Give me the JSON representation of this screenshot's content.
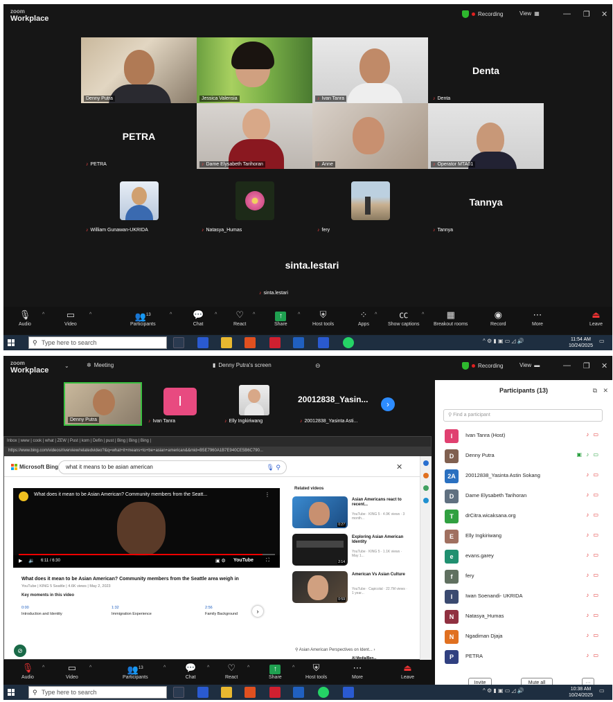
{
  "app": {
    "logo_top": "zoom",
    "logo_bottom": "Workplace"
  },
  "shot1": {
    "recording": "Recording",
    "view": "View",
    "tiles": [
      {
        "name": "Denny Putra"
      },
      {
        "name": "Jessica Valensia"
      },
      {
        "name": "Ivan Tanra"
      },
      {
        "name": "Denta",
        "big": "Denta"
      },
      {
        "name": "PETRA",
        "big": "PETRA"
      },
      {
        "name": "Dame Elysabeth Tarihoran"
      },
      {
        "name": "Anne"
      },
      {
        "name": "Operator MTA01"
      },
      {
        "name": "William Gunawan-UKRIDA"
      },
      {
        "name": "Natasya_Humas"
      },
      {
        "name": "fery"
      },
      {
        "name": "Tannya",
        "big": "Tannya"
      },
      {
        "name": "sinta.lestari",
        "big": "sinta.lestari"
      }
    ],
    "participant_count": "13",
    "clock_time": "11:54 AM",
    "clock_date": "10/24/2025"
  },
  "toolbar1": {
    "audio": "Audio",
    "video": "Video",
    "participants": "Participants",
    "chat": "Chat",
    "react": "React",
    "share": "Share",
    "host_tools": "Host tools",
    "apps": "Apps",
    "captions": "Show captions",
    "breakout": "Breakout rooms",
    "record": "Record",
    "more": "More",
    "leave": "Leave"
  },
  "taskbar": {
    "search_placeholder": "Type here to search"
  },
  "shot2": {
    "meeting": "Meeting",
    "screen_label": "Denny Putra's screen",
    "recording": "Recording",
    "view": "View",
    "strip": [
      {
        "name": "Denny Putra"
      },
      {
        "name": "Ivan Tanra",
        "initial": "I"
      },
      {
        "name": "Elly Ingkiriwang"
      },
      {
        "name": "20012838_Yasinta Asti...",
        "big": "20012838_Yasin..."
      }
    ],
    "clock_time": "10:38 AM",
    "clock_date": "10/24/2025",
    "participant_count": "13"
  },
  "browser": {
    "tabs": "Inbox | www | cook | what | ZEW | Pust | kom | Defin | pust | Bing | Bing | Bing | ",
    "url": "https://www.bing.com/videos/riverview/relatedvideo?&q=what+it+means+to+be+asian+american&&mid=B5E7960A1B7E940CE5B6C790..."
  },
  "bing": {
    "logo": "Microsoft Bing",
    "query": "what it means to be asian american",
    "video_title": "What does it mean to be Asian American? Community members from the Seatt...",
    "video_time": "6:11 / 6:30",
    "video_heading": "What does it mean to be Asian American? Community members from the Seattle area weigh in",
    "video_meta": "YouTube | KING 5 Seattle | 4.6K views | May 2, 2023",
    "key_moments": "Key moments in this video",
    "chapters": [
      {
        "time": "0:00",
        "label": "Introduction and Identity"
      },
      {
        "time": "1:32",
        "label": "Immigration Experience"
      },
      {
        "time": "2:56",
        "label": "Family Background"
      }
    ],
    "related_heading": "Related videos",
    "related": [
      {
        "title": "Asian Americans react to recent...",
        "meta": "YouTube · KING 5 · 4.9K views · 3 month...",
        "duration": "0:27"
      },
      {
        "title": "Exploring Asian American Identity",
        "meta": "YouTube · KING 5 · 1.1K views · May 1...",
        "duration": "2:14"
      },
      {
        "title": "American Vs Asian Culture",
        "meta": "YouTube · Capicolal · 22.7M views · 1 year...",
        "duration": "0:59"
      }
    ],
    "related_bar": "Asian American Perspectives on Ident...",
    "partial": "AI Media/Ben..."
  },
  "toolbar2": {
    "audio": "Audio",
    "video": "Video",
    "participants": "Participants",
    "chat": "Chat",
    "react": "React",
    "share": "Share",
    "host_tools": "Host tools",
    "more": "More",
    "leave": "Leave"
  },
  "panel": {
    "title": "Participants (13)",
    "find_placeholder": "Find a participant",
    "participants": [
      {
        "name": "Ivan Tanra (Host)",
        "initial": "I",
        "color": "#e04070"
      },
      {
        "name": "Denny Putra",
        "initial": "D",
        "color": "#806050"
      },
      {
        "name": "20012838_Yasinta Astin Sokang",
        "initial": "2A",
        "color": "#2a70c0"
      },
      {
        "name": "Dame Elysabeth Tarihoran",
        "initial": "D",
        "color": "#607080"
      },
      {
        "name": "drCitra.wicaksana.org",
        "initial": "T",
        "color": "#30a040"
      },
      {
        "name": "Elly Ingkiriwang",
        "initial": "E",
        "color": "#a07060"
      },
      {
        "name": "evans.garey",
        "initial": "e",
        "color": "#209070"
      },
      {
        "name": "fery",
        "initial": "f",
        "color": "#607060"
      },
      {
        "name": "Iwan Soenandi- UKRIDA",
        "initial": "I",
        "color": "#3a4a70"
      },
      {
        "name": "Natasya_Humas",
        "initial": "N",
        "color": "#903040"
      },
      {
        "name": "Ngadiman Djaja",
        "initial": "N",
        "color": "#e07020"
      },
      {
        "name": "PETRA",
        "initial": "P",
        "color": "#304080"
      }
    ],
    "invite": "Invite",
    "mute_all": "Mute all",
    "more": "···"
  }
}
